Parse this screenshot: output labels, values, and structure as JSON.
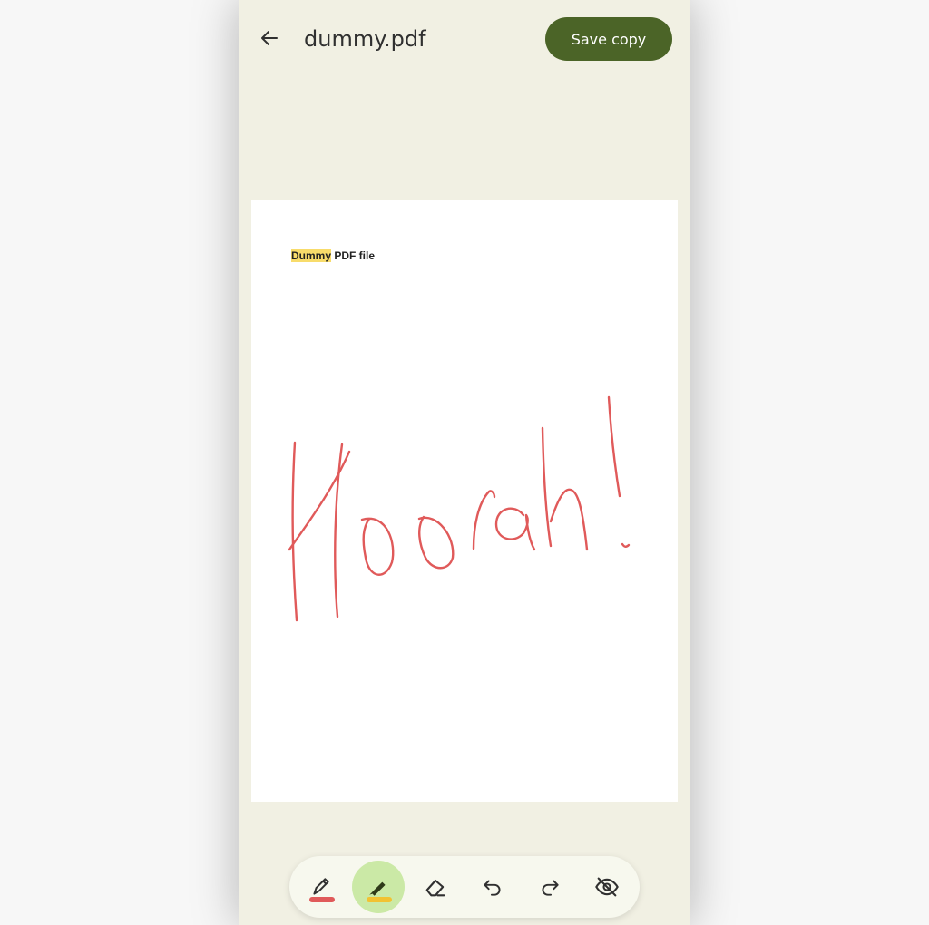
{
  "header": {
    "back_icon": "arrow-left-icon",
    "title": "dummy.pdf",
    "save_label": "Save copy"
  },
  "document": {
    "heading_highlighted": "Dummy",
    "heading_rest": " PDF file",
    "highlight_color": "#f8dc6b",
    "annotation_ink_color": "#e05a5a"
  },
  "toolbar": {
    "tools": [
      {
        "name": "pen",
        "icon": "pen-icon",
        "color": "#e05a5a",
        "active": false
      },
      {
        "name": "highlighter",
        "icon": "highlighter-icon",
        "color": "#f2c232",
        "active": true
      },
      {
        "name": "eraser",
        "icon": "eraser-icon",
        "active": false
      },
      {
        "name": "undo",
        "icon": "undo-icon",
        "active": false
      },
      {
        "name": "redo",
        "icon": "redo-icon",
        "active": false
      },
      {
        "name": "hide-annotations",
        "icon": "eye-off-icon",
        "active": false
      }
    ]
  },
  "colors": {
    "background": "#f1f0e3",
    "accent": "#4b6427",
    "active_tool": "#cbe9a6"
  }
}
